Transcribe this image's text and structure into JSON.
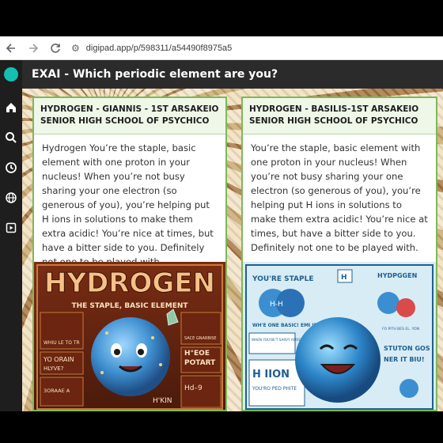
{
  "browser": {
    "url": "digipad.app/p/598311/a54490f8975a5",
    "back_icon": "arrow-left-icon",
    "forward_icon": "arrow-right-icon",
    "reload_icon": "reload-icon",
    "site_info_icon": "tune-icon"
  },
  "sidebar": {
    "icons": [
      "home-icon",
      "search-icon",
      "clock-icon",
      "globe-icon",
      "play-icon"
    ]
  },
  "app": {
    "title": "EXAI - Which periodic element are you?"
  },
  "cards": [
    {
      "title": "HYDROGEN - GIANNIS - 1ST ARSAKEIO SENIOR HIGH SCHOOL OF PSYCHICO",
      "body": "  Hydrogen You’re the staple, basic element with one proton in your nucleus! When you’re not busy sharing your one electron (so generous of you), you’re helping put H ions in solutions to make them extra acidic! You’re nice at times, but have a bitter side to you. Definitely not one to be played with",
      "image": {
        "headline": "HYDROGEN",
        "subtitle": "THE STAPLE, BASIC ELEMENT",
        "snippets": [
          "H°EOE",
          "POTART",
          "YO ORAIN",
          "HLYVE?",
          "H'KIN",
          "Hd–9",
          "WHIU LE TO TR",
          "3ORAAE A",
          "SACE GNARBISE"
        ]
      }
    },
    {
      "title": "HYDROGEN - BASILIS-1ST ARSAKEIO SENIOR HIGH SCHOOL OF PSYCHICO",
      "body": "You’re the staple, basic element with one proton in your nucleus! When you’re not busy sharing your one electron (so generous of you), you’re helping put H ions in solutions to make them extra acidic! You’re nice at times, but have a bitter side to you. Definitely not one to be played with.",
      "image": {
        "headline": "YOU'RE STAPLE",
        "right_headline": "HYDPGGEN",
        "snippets": [
          "WH'E ONE BASIC! EMI IE",
          "H IION",
          "YOU'RO PED PHITE",
          "STUTON GOS",
          "NER IT BIU!",
          "WHEN YOU'BE'T SARVY APROTE",
          "FO PITH BES EL. YON"
        ]
      }
    }
  ]
}
